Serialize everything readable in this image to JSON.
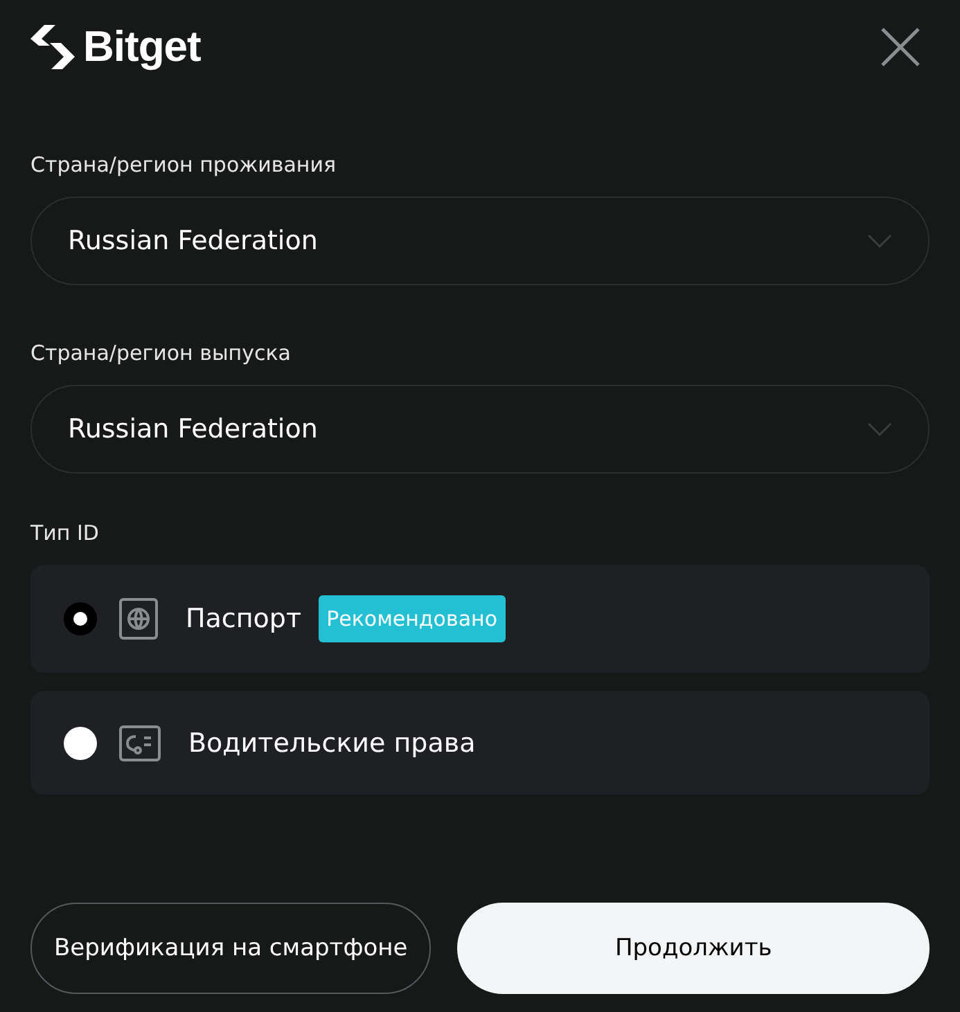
{
  "header": {
    "logo": "Bitget"
  },
  "fields": [
    {
      "label": "Страна/регион проживания",
      "value": "Russian Federation"
    },
    {
      "label": "Страна/регион выпуска",
      "value": "Russian Federation"
    }
  ],
  "id_type": {
    "label": "Тип ID",
    "options": [
      {
        "kind": "passport",
        "label": "Паспорт",
        "badge": "Рекомендовано",
        "selected": true
      },
      {
        "kind": "license",
        "label": "Водительские права",
        "selected": false
      }
    ]
  },
  "buttons": [
    {
      "kind": "secondary",
      "label": "Верификация на смартфоне"
    },
    {
      "kind": "primary",
      "label": "Продолжить"
    }
  ]
}
